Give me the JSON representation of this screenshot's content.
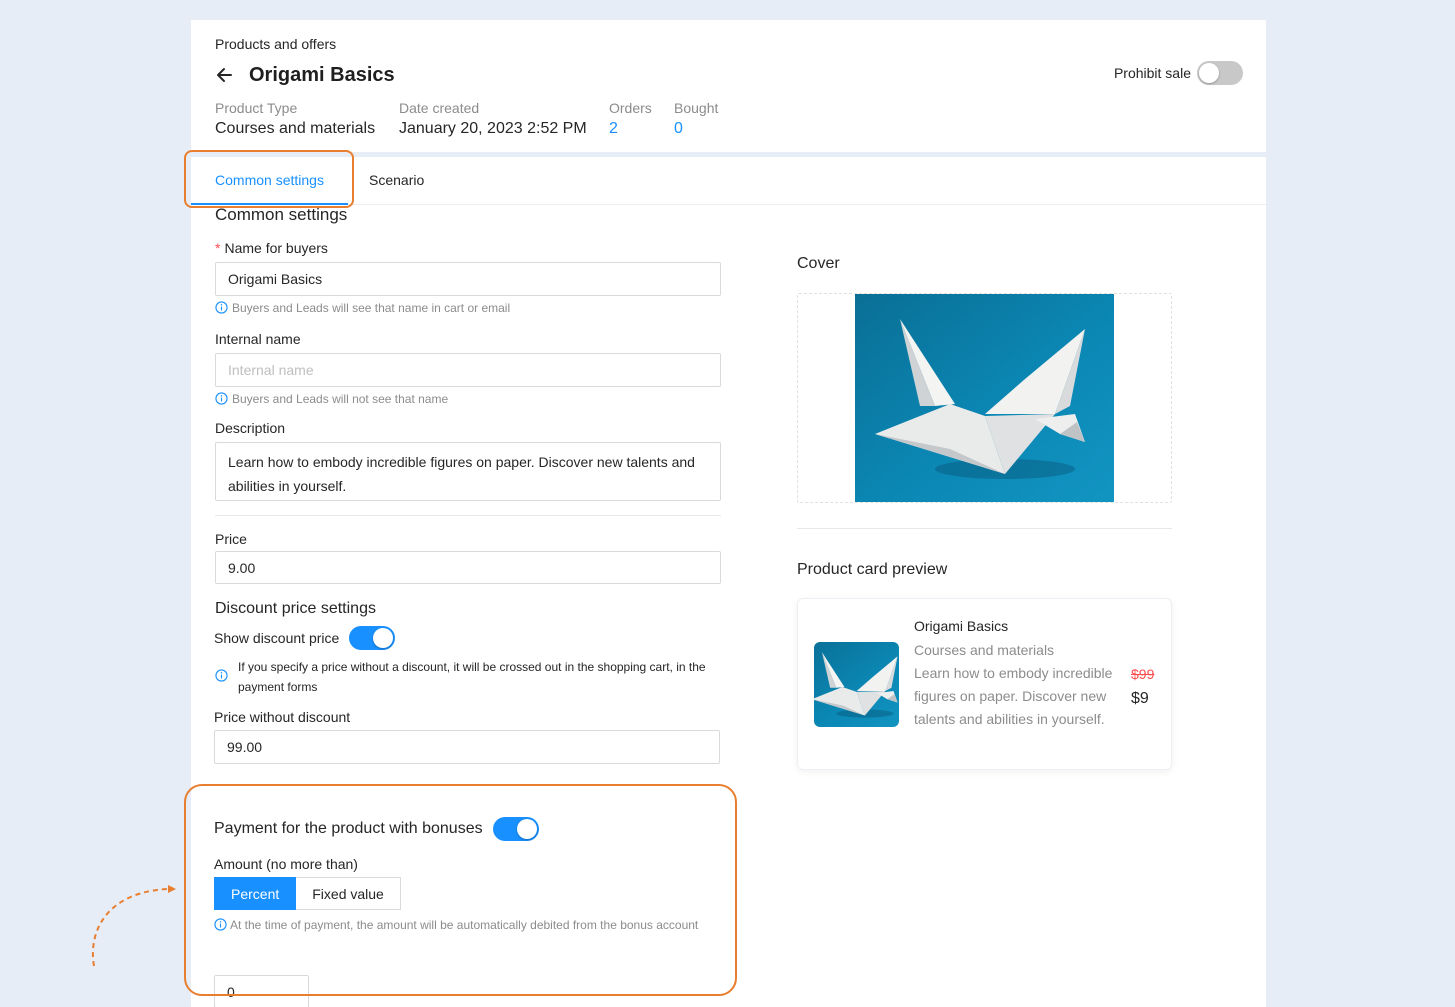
{
  "header": {
    "breadcrumb": "Products and offers",
    "title": "Origami Basics",
    "prohibit_sale_label": "Prohibit sale",
    "prohibit_sale_on": false,
    "meta": {
      "product_type_label": "Product Type",
      "product_type_value": "Courses and materials",
      "date_created_label": "Date created",
      "date_created_value": "January 20, 2023 2:52 PM",
      "orders_label": "Orders",
      "orders_value": "2",
      "bought_label": "Bought",
      "bought_value": "0"
    }
  },
  "tabs": [
    {
      "label": "Common settings",
      "active": true
    },
    {
      "label": "Scenario",
      "active": false
    }
  ],
  "form": {
    "section_title": "Common settings",
    "name_label": "Name for buyers",
    "name_value": "Origami Basics",
    "name_hint": "Buyers and Leads will see that name in cart or email",
    "internal_label": "Internal name",
    "internal_placeholder": "Internal name",
    "internal_hint": "Buyers and Leads will not see that name",
    "description_label": "Description",
    "description_value": "Learn how to embody incredible figures on paper. Discover new talents and abilities in yourself.",
    "price_label": "Price",
    "price_value": "9.00",
    "discount_section_title": "Discount price settings",
    "show_discount_label": "Show discount price",
    "show_discount_on": true,
    "discount_hint": "If you specify a price without a discount, it will be crossed out in the shopping cart, in the payment forms",
    "price_without_discount_label": "Price without discount",
    "price_without_discount_value": "99.00",
    "bonus_label": "Payment for the product with bonuses",
    "bonus_on": true,
    "amount_label": "Amount (no more than)",
    "amount_options": [
      "Percent",
      "Fixed value"
    ],
    "amount_selected": "Percent",
    "amount_hint": "At the time of payment, the amount will be automatically debited from the bonus account",
    "amount_value": "0"
  },
  "cover": {
    "label": "Cover",
    "image": "origami-crane-on-blue"
  },
  "preview": {
    "label": "Product card preview",
    "title": "Origami Basics",
    "type": "Courses and materials",
    "description": "Learn how to embody incredible figures on paper. Discover new talents and abilities in yourself.",
    "old_price": "$99",
    "new_price": "$9"
  },
  "colors": {
    "accent": "#1890ff",
    "highlight_outline": "#e87e2f",
    "background": "#e6edf7"
  }
}
